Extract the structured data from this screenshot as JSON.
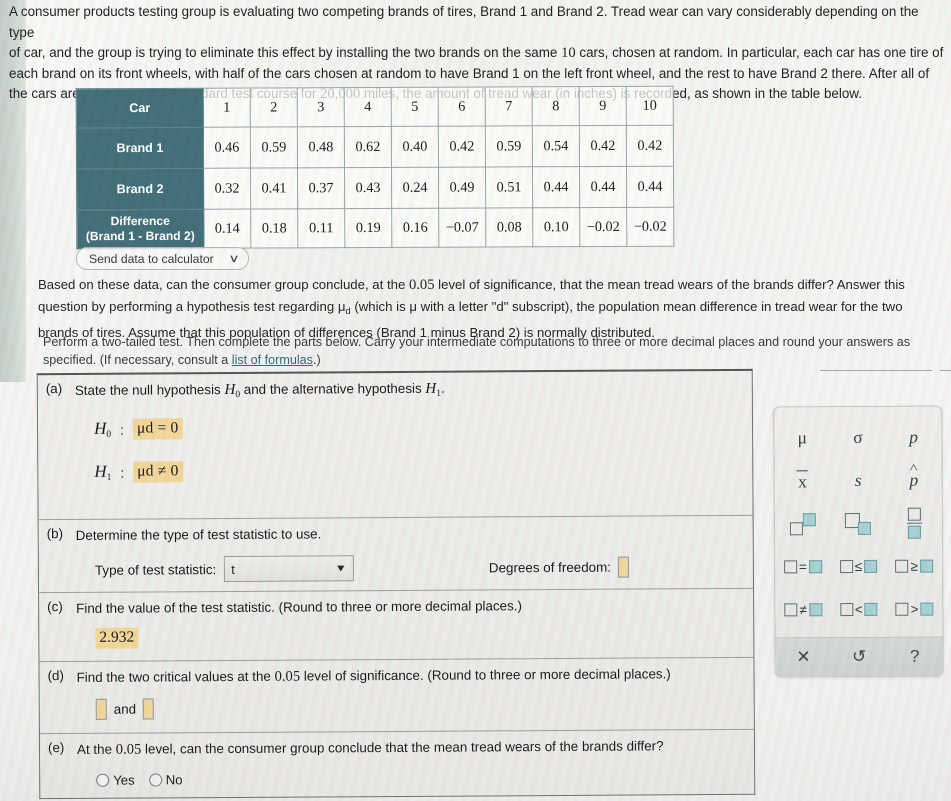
{
  "intro": {
    "line1": "A consumer products testing group is evaluating two competing brands of tires, Brand 1 and Brand 2. Tread wear can vary considerably depending on the type",
    "line2_a": "of car, and the group is trying to eliminate this effect by installing the two brands on the same ",
    "line2_num": "10",
    "line2_b": " cars, chosen at random. In particular, each car has one tire of",
    "line3": "each brand on its front wheels, with half of the cars chosen at random to have Brand 1 on the left front wheel, and the rest to have Brand 2 there. After all of",
    "line4_a": "the cars are driven over the standard test course for ",
    "line4_num": "20,000",
    "line4_b": " miles, the amount of tread wear (in inches) is recorded, as shown in the table below."
  },
  "table": {
    "header_label": "Car",
    "cars": [
      "1",
      "2",
      "3",
      "4",
      "5",
      "6",
      "7",
      "8",
      "9",
      "10"
    ],
    "rows": [
      {
        "label": "Brand 1",
        "label_line2": "",
        "values": [
          "0.46",
          "0.59",
          "0.48",
          "0.62",
          "0.40",
          "0.42",
          "0.59",
          "0.54",
          "0.42",
          "0.42"
        ]
      },
      {
        "label": "Brand 2",
        "label_line2": "",
        "values": [
          "0.32",
          "0.41",
          "0.37",
          "0.43",
          "0.24",
          "0.49",
          "0.51",
          "0.44",
          "0.44",
          "0.44"
        ]
      },
      {
        "label": "Difference",
        "label_line2": "(Brand 1 - Brand 2)",
        "values": [
          "0.14",
          "0.18",
          "0.11",
          "0.19",
          "0.16",
          "−0.07",
          "0.08",
          "0.10",
          "−0.02",
          "−0.02"
        ]
      }
    ],
    "header_bg": "#44707a"
  },
  "send_to_calculator": {
    "label": "Send data to calculator",
    "caret": "∨"
  },
  "paragraphs": {
    "p1_a": "Based on these data, can the consumer group conclude, at the ",
    "p1_alpha": "0.05",
    "p1_b": " level of significance, that the mean tread wears of the brands differ? Answer this question by performing a hypothesis test regarding μ",
    "p1_sub": "d",
    "p1_c": " (which is μ with a letter \"d\" subscript), the population mean difference in tread wear for the two brands of tires. Assume that this population of differences (Brand 1 minus Brand 2) is normally distributed.",
    "p2_a": "Perform a two-tailed test. Then complete the parts below. Carry your intermediate computations to three or more decimal places and round your answers as specified. (If necessary, consult a ",
    "p2_link": "list of formulas",
    "p2_b": ".)"
  },
  "sections": {
    "a": {
      "letter": "(a)",
      "title_a": "State the null hypothesis ",
      "title_h0": "H",
      "title_h0sub": "0",
      "title_b": " and the alternative hypothesis ",
      "title_h1": "H",
      "title_h1sub": "1",
      "title_c": ".",
      "h0_name": "H",
      "h0_sub": "0",
      "h0_value": "μd = 0",
      "h1_name": "H",
      "h1_sub": "1",
      "h1_value": "μd ≠ 0",
      "colon": ":"
    },
    "b": {
      "letter": "(b)",
      "title": "Determine the type of test statistic to use.",
      "select_label": "Type of test statistic:",
      "select_value": "t",
      "select_arrow": "▼",
      "dof_label": "Degrees of freedom:",
      "dof_value": ""
    },
    "c": {
      "letter": "(c)",
      "title_a": "Find the value of the test statistic. (Round to three or more decimal places.)",
      "value": "2.932"
    },
    "d": {
      "letter": "(d)",
      "title_a": "Find the two critical values at the ",
      "title_alpha": "0.05",
      "title_b": " level of significance. (Round to three or more decimal places.)",
      "value_1": "",
      "and_label": "and",
      "value_2": ""
    },
    "e": {
      "letter": "(e)",
      "title_a": "At the ",
      "title_alpha": "0.05",
      "title_b": " level, can the consumer group conclude that the mean tread wears of the brands differ?",
      "option_yes": "Yes",
      "option_no": "No"
    }
  },
  "keypad": {
    "symbols": [
      {
        "name": "mu",
        "glyph": "μ"
      },
      {
        "name": "sigma",
        "glyph": "σ"
      },
      {
        "name": "p",
        "glyph": "p"
      },
      {
        "name": "x-bar",
        "glyph": "x"
      },
      {
        "name": "s",
        "glyph": "s"
      },
      {
        "name": "p-hat",
        "glyph": "p"
      }
    ],
    "operators": [
      {
        "name": "equals",
        "glyph": "="
      },
      {
        "name": "less-equal",
        "glyph": "≤"
      },
      {
        "name": "greater-equal",
        "glyph": "≥"
      },
      {
        "name": "not-equal",
        "glyph": "≠"
      },
      {
        "name": "less-than",
        "glyph": "<"
      },
      {
        "name": "greater-than",
        "glyph": ">"
      }
    ],
    "actions": [
      {
        "name": "clear",
        "glyph": "✕"
      },
      {
        "name": "undo",
        "glyph": "↺"
      },
      {
        "name": "help",
        "glyph": "?"
      }
    ],
    "accent": "#a8d2d4"
  }
}
